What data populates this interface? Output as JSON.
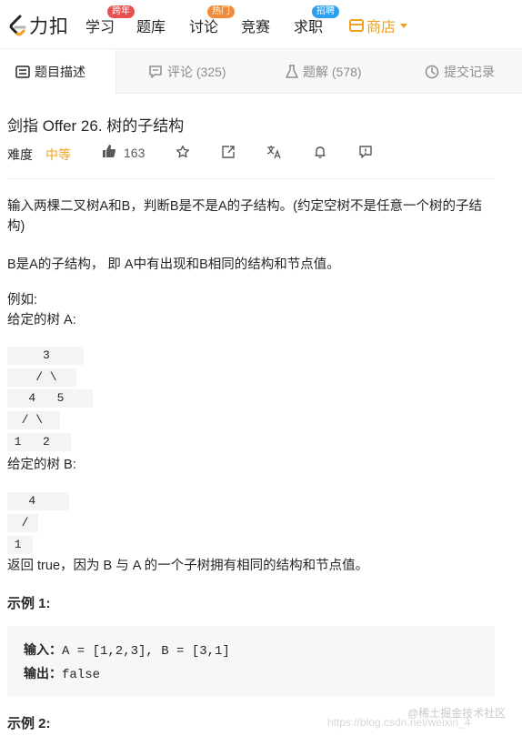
{
  "nav": {
    "logo_text": "力扣",
    "items": [
      {
        "label": "学习",
        "badge": "跨年"
      },
      {
        "label": "题库",
        "badge": ""
      },
      {
        "label": "讨论",
        "badge": "热门"
      },
      {
        "label": "竞赛",
        "badge": ""
      },
      {
        "label": "求职",
        "badge": "招聘"
      }
    ],
    "store_label": "商店"
  },
  "tabs": [
    {
      "label": "题目描述",
      "icon": "description-icon"
    },
    {
      "label": "评论 (325)",
      "icon": "comment-icon"
    },
    {
      "label": "题解 (578)",
      "icon": "flask-icon"
    },
    {
      "label": "提交记录",
      "icon": "history-icon"
    }
  ],
  "problem": {
    "title": "剑指 Offer 26. 树的子结构",
    "difficulty_label": "难度",
    "difficulty": "中等",
    "likes": "163"
  },
  "description": {
    "p1": "输入两棵二叉树A和B，判断B是不是A的子结构。(约定空树不是任意一个树的子结构)",
    "p2": "B是A的子结构， 即 A中有出现和B相同的结构和节点值。",
    "example_intro": "例如:",
    "tree_a_label": "给定的树 A:",
    "tree_a": [
      "     3",
      "    / \\",
      "   4   5",
      "  / \\",
      " 1   2"
    ],
    "tree_b_label": "给定的树 B:",
    "tree_b": [
      "   4 ",
      "  /",
      " 1"
    ],
    "return_text": "返回 true，因为 B 与 A 的一个子树拥有相同的结构和节点值。"
  },
  "examples": [
    {
      "title": "示例 1:",
      "input_label": "输入：",
      "input": "A = [1,2,3], B = [3,1]",
      "output_label": "输出：",
      "output": "false"
    },
    {
      "title": "示例 2:"
    }
  ],
  "watermark": {
    "site": "@稀土掘金技术社区",
    "url": "https://blog.csdn.net/weixin_4"
  }
}
